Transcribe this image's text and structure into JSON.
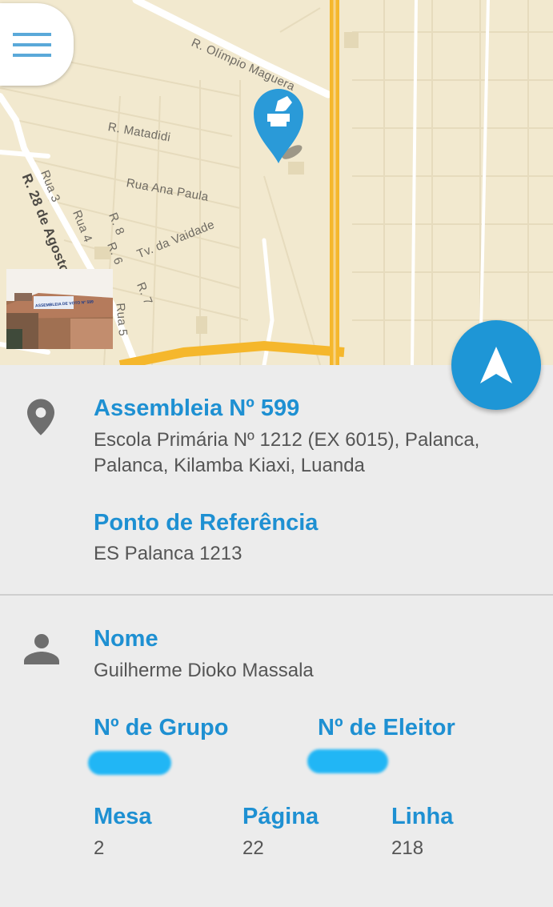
{
  "map": {
    "streets": {
      "olimpio": "R. Olímpio Maguera",
      "matadidi": "R. Matadidi",
      "ana_paula": "Rua Ana Paula",
      "vaidade": "Tv. da Vaidade",
      "agosto": "R. 28 de Agosto",
      "rua3": "Rua 3",
      "rua4": "Rua 4",
      "r8": "R. 8",
      "r6": "R. 6",
      "r7": "R. 7",
      "rua5": "Rua 5"
    },
    "photo_sign": "ASSEMBLEIA DE VOTO Nº 599"
  },
  "location": {
    "title": "Assembleia Nº 599",
    "address_line1": "Escola Primária Nº 1212 (EX 6015), Palanca,",
    "address_line2": "Palanca, Kilamba Kiaxi, Luanda",
    "reference_label": "Ponto de Referência",
    "reference_value": "ES Palanca 1213"
  },
  "voter": {
    "name_label": "Nome",
    "name_value": "Guilherme Dioko Massala",
    "group_label": "Nº de Grupo",
    "elector_label": "Nº de Eleitor",
    "mesa_label": "Mesa",
    "mesa_value": "2",
    "pagina_label": "Página",
    "pagina_value": "22",
    "linha_label": "Linha",
    "linha_value": "218"
  },
  "colors": {
    "accent": "#1e90d2",
    "nav_button": "#1e96d6",
    "highway": "#f5b72c",
    "redaction": "#21b6f5"
  },
  "icons": [
    "menu-icon",
    "ballot-pin-icon",
    "navigation-arrow-icon",
    "location-pin-icon",
    "person-icon"
  ]
}
